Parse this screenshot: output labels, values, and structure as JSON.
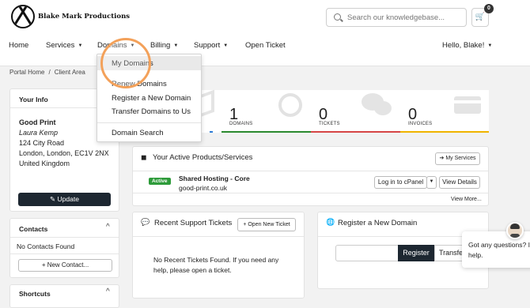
{
  "brand": {
    "name": "Blake Mark Productions"
  },
  "search": {
    "placeholder": "Search our knowledgebase..."
  },
  "cart": {
    "count": "0"
  },
  "nav": {
    "home": "Home",
    "services": "Services",
    "domains": "Domains",
    "billing": "Billing",
    "support": "Support",
    "open_ticket": "Open Ticket",
    "user": "Hello, Blake!"
  },
  "domains_menu": {
    "items": [
      "My Domains",
      "Renew Domains",
      "Register a New Domain",
      "Transfer Domains to Us",
      "Domain Search"
    ]
  },
  "breadcrumb": {
    "home": "Portal Home",
    "separator": "/",
    "current": "Client Area"
  },
  "your_info": {
    "title": "Your Info",
    "company": "Good Print",
    "name": "Laura Kemp",
    "address1": "124 City Road",
    "address2": "London, London, EC1V 2NX",
    "country": "United Kingdom",
    "update": "Update"
  },
  "contacts": {
    "title": "Contacts",
    "empty": "No Contacts Found",
    "new_btn": "+ New Contact..."
  },
  "shortcuts": {
    "title": "Shortcuts"
  },
  "stats": [
    {
      "value": "1",
      "label": "DOMAINS",
      "color": "#2b8a2f"
    },
    {
      "value": "0",
      "label": "TICKETS",
      "color": "#d64545"
    },
    {
      "value": "0",
      "label": "INVOICES",
      "color": "#f0b400"
    }
  ],
  "products": {
    "title": "Your Active Products/Services",
    "my_services": "My Services",
    "row": {
      "status": "Active",
      "name": "Shared Hosting - Core",
      "domain": "good-print.co.uk",
      "cpanel": "Log in to cPanel",
      "details": "View Details"
    },
    "view_more": "View More..."
  },
  "tickets": {
    "title": "Recent Support Tickets",
    "open_new": "+ Open New Ticket",
    "empty_line1": "No Recent Tickets Found. If you need any",
    "empty_line2": "help, please open a ticket."
  },
  "register": {
    "title": "Register a New Domain",
    "register_btn": "Register",
    "transfer_btn": "Transfer"
  },
  "chat": {
    "line1": "Got any questions? I'm",
    "line2": "help."
  },
  "colors": {
    "accent_dark": "#1d2731",
    "active_green": "#2e9b3a",
    "highlight_orange": "#f3a15a",
    "update_blue": "#2e7bd6"
  }
}
